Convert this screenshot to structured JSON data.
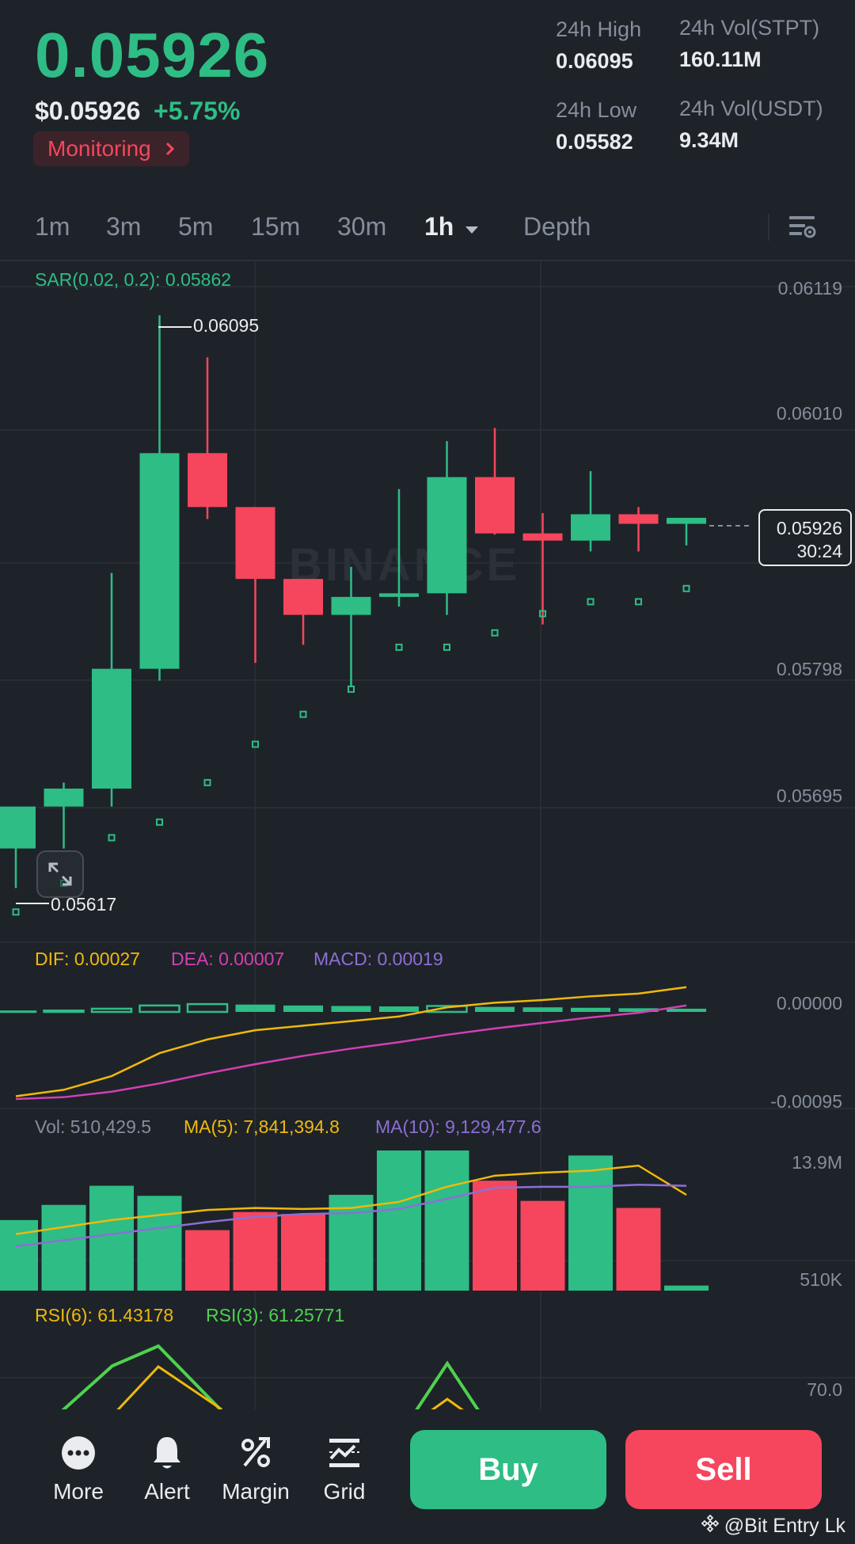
{
  "ticker": {
    "last_price": "0.05926",
    "usd_price": "$0.05926",
    "change": "+5.75%",
    "monitoring_label": "Monitoring",
    "stats": {
      "high_label": "24h High",
      "high_value": "0.06095",
      "low_label": "24h Low",
      "low_value": "0.05582",
      "vol_base_label": "24h Vol(STPT)",
      "vol_base_value": "160.11M",
      "vol_quote_label": "24h Vol(USDT)",
      "vol_quote_value": "9.34M"
    }
  },
  "timeframes": {
    "items": [
      "1m",
      "3m",
      "5m",
      "15m",
      "30m",
      "1h"
    ],
    "active": "1h",
    "depth_label": "Depth"
  },
  "chart_data": {
    "type": "candlestick",
    "interval": "1h",
    "y_axis_ticks": [
      "0.06119",
      "0.06010",
      "0.05798",
      "0.05695"
    ],
    "ylim": [
      0.056,
      0.0613
    ],
    "high_marker": "0.06095",
    "low_marker": "0.05617",
    "current_price_tag": "0.05926",
    "countdown": "30:24",
    "watermark": "BINANCE",
    "candles": [
      {
        "o": 0.0565,
        "h": 0.05675,
        "l": 0.05617,
        "c": 0.05685
      },
      {
        "o": 0.05685,
        "h": 0.05705,
        "l": 0.0565,
        "c": 0.057
      },
      {
        "o": 0.057,
        "h": 0.0588,
        "l": 0.05685,
        "c": 0.058
      },
      {
        "o": 0.058,
        "h": 0.06095,
        "l": 0.0579,
        "c": 0.0598
      },
      {
        "o": 0.0598,
        "h": 0.0606,
        "l": 0.05925,
        "c": 0.05935
      },
      {
        "o": 0.05935,
        "h": 0.05935,
        "l": 0.05805,
        "c": 0.05875
      },
      {
        "o": 0.05875,
        "h": 0.05875,
        "l": 0.0582,
        "c": 0.05845
      },
      {
        "o": 0.05845,
        "h": 0.05885,
        "l": 0.05785,
        "c": 0.0586
      },
      {
        "o": 0.0586,
        "h": 0.0595,
        "l": 0.05852,
        "c": 0.05863
      },
      {
        "o": 0.05863,
        "h": 0.0599,
        "l": 0.05845,
        "c": 0.0596
      },
      {
        "o": 0.0596,
        "h": 0.06001,
        "l": 0.05912,
        "c": 0.05913
      },
      {
        "o": 0.05913,
        "h": 0.0593,
        "l": 0.05837,
        "c": 0.05907
      },
      {
        "o": 0.05907,
        "h": 0.05965,
        "l": 0.05898,
        "c": 0.05929
      },
      {
        "o": 0.05929,
        "h": 0.05935,
        "l": 0.05898,
        "c": 0.05921
      },
      {
        "o": 0.05921,
        "h": 0.05926,
        "l": 0.05903,
        "c": 0.05926
      }
    ],
    "sar_points": [
      0.05597,
      0.05621,
      0.05659,
      0.05672,
      0.05705,
      0.05737,
      0.05762,
      0.05783,
      0.05818,
      0.05818,
      0.0583,
      0.05846,
      0.05856,
      0.05856,
      0.05867
    ],
    "indicators": {
      "sar_label": "SAR(0.02, 0.2): 0.05862",
      "dif_label": "DIF: 0.00027",
      "dea_label": "DEA: 0.00007",
      "macd_label": "MACD: 0.00019",
      "macd_axis": [
        "0.00000",
        "-0.00095"
      ],
      "macd_hist": [
        5e-06,
        1.5e-05,
        3.5e-05,
        7e-05,
        8.5e-05,
        8e-05,
        7e-05,
        6.5e-05,
        6e-05,
        6.5e-05,
        5.5e-05,
        5e-05,
        4.5e-05,
        4e-05,
        3.5e-05
      ],
      "dif": [
        -0.00092,
        -0.00085,
        -0.0007,
        -0.00045,
        -0.0003,
        -0.0002,
        -0.00015,
        -0.0001,
        -5e-05,
        5e-05,
        0.0001,
        0.00013,
        0.00017,
        0.0002,
        0.00027
      ],
      "dea": [
        -0.00095,
        -0.00093,
        -0.00087,
        -0.00078,
        -0.00067,
        -0.00057,
        -0.00048,
        -0.0004,
        -0.00033,
        -0.00025,
        -0.00018,
        -0.00012,
        -6e-05,
        -1e-05,
        7e-05
      ],
      "vol_label": "Vol: 510,429.5",
      "ma5_label": "MA(5): 7,841,394.8",
      "ma10_label": "MA(10): 9,129,477.6",
      "vol_axis": [
        "13.9M",
        "510K"
      ],
      "volume": [
        7.0,
        8.5,
        10.4,
        9.4,
        6.0,
        7.8,
        7.6,
        9.5,
        13.9,
        13.9,
        10.9,
        8.9,
        13.4,
        8.2,
        0.5
      ],
      "vol_up": [
        true,
        true,
        true,
        true,
        false,
        false,
        false,
        true,
        true,
        true,
        false,
        false,
        true,
        false,
        true
      ],
      "ma5": [
        5.6,
        6.3,
        7.0,
        7.5,
        8.0,
        8.2,
        8.1,
        8.2,
        8.8,
        10.3,
        11.4,
        11.7,
        11.9,
        12.4,
        9.5
      ],
      "ma10": [
        4.4,
        5.0,
        5.6,
        6.2,
        6.8,
        7.3,
        7.6,
        7.7,
        8.1,
        9.1,
        10.2,
        10.3,
        10.3,
        10.5,
        10.4
      ],
      "rsi6_label": "RSI(6): 61.43178",
      "rsi3_label": "RSI(3): 61.25771",
      "rsi_axis": "70.0"
    }
  },
  "bottom_nav": {
    "more": "More",
    "alert": "Alert",
    "margin": "Margin",
    "grid": "Grid",
    "buy": "Buy",
    "sell": "Sell"
  },
  "credit": "@Bit Entry Lk",
  "colors": {
    "up": "#2ebd85",
    "down": "#f6465d",
    "dif": "#f0b90b",
    "dea": "#d43fb4",
    "ma10": "#8d6ed6",
    "rsi3": "#4fd14f"
  }
}
